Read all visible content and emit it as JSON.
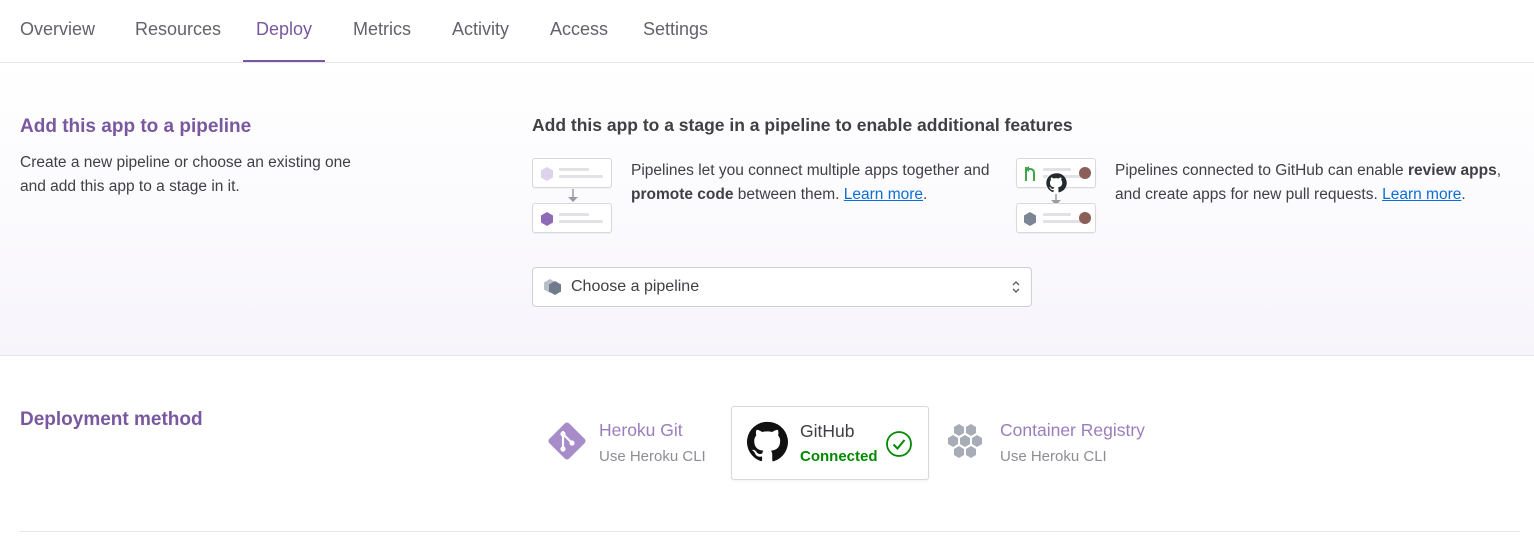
{
  "tabs": [
    {
      "label": "Overview"
    },
    {
      "label": "Resources"
    },
    {
      "label": "Deploy"
    },
    {
      "label": "Metrics"
    },
    {
      "label": "Activity"
    },
    {
      "label": "Access"
    },
    {
      "label": "Settings"
    }
  ],
  "active_tab": "Deploy",
  "pipeline": {
    "title": "Add this app to a pipeline",
    "description": "Create a new pipeline or choose an existing one and add this app to a stage in it.",
    "heading": "Add this app to a stage in a pipeline to enable additional features",
    "feature1": {
      "text_a": "Pipelines let you connect multiple apps together and ",
      "bold": "promote code",
      "text_b": " between them. ",
      "link": "Learn more",
      "tail": "."
    },
    "feature2": {
      "text_a": "Pipelines connected to GitHub can enable ",
      "bold": "review apps",
      "text_b": ", and create apps for new pull requests. ",
      "link": "Learn more",
      "tail": "."
    },
    "select_value": "Choose a pipeline"
  },
  "deployment": {
    "title": "Deployment method",
    "methods": [
      {
        "name": "Heroku Git",
        "sub": "Use Heroku CLI",
        "icon": "git-icon"
      },
      {
        "name": "GitHub",
        "sub": "Connected",
        "icon": "github-icon",
        "selected": true
      },
      {
        "name": "Container Registry",
        "sub": "Use Heroku CLI",
        "icon": "container-registry-icon"
      }
    ]
  },
  "colors": {
    "accent": "#79589f",
    "link": "#0b6ed6",
    "connected": "#008a00"
  }
}
